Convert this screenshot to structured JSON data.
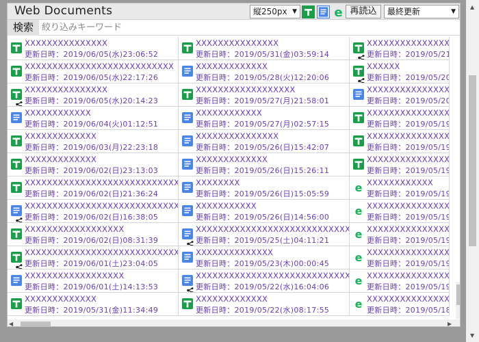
{
  "header": {
    "title": "Web Documents",
    "size_select": "縦250px",
    "reload_label": "再読込",
    "sort_select": "最終更新"
  },
  "search": {
    "label": "検索",
    "placeholder": "絞り込みキーワード",
    "value": ""
  },
  "colors": {
    "sheet": "#1a9e4a",
    "doc": "#4a86e8",
    "site": "#19b35a",
    "text": "#6a3db8"
  },
  "columns": [
    [
      {
        "type": "sheet-icon",
        "shared": false,
        "title": "XXXXXXXXXXXXXXX",
        "date": "更新日時：2019/06/05(水)23:06:52"
      },
      {
        "type": "sheet-icon",
        "shared": false,
        "title": "XXXXXXXXXXXXXXXXXXXXXXXXXXX",
        "date": "更新日時：2019/06/05(水)22:17:26"
      },
      {
        "type": "sheet-icon",
        "shared": true,
        "title": "XXXXXXXXXXXXXXX",
        "date": "更新日時：2019/06/05(水)20:14:23"
      },
      {
        "type": "doc-icon",
        "shared": false,
        "title": "XXXXXXXXXXXX",
        "date": "更新日時：2019/06/04(火)01:12:51"
      },
      {
        "type": "sheet-icon",
        "shared": false,
        "title": "XXXXXXXXXXXXX",
        "date": "更新日時：2019/06/03(月)22:23:18"
      },
      {
        "type": "sheet-icon",
        "shared": false,
        "title": "XXXXXXXXXXXXX",
        "date": "更新日時：2019/06/02(日)23:13:03"
      },
      {
        "type": "sheet-icon",
        "shared": false,
        "title": "XXXXXXXXXXXXXXXXXXXXXXXXXXXXXX",
        "date": "更新日時：2019/06/02(日)21:36:24"
      },
      {
        "type": "doc-icon",
        "shared": true,
        "title": "XXXXXXXXXXXXXXXXXXXXXXXXXXXXX",
        "date": "更新日時：2019/06/02(日)16:38:05"
      },
      {
        "type": "sheet-icon",
        "shared": false,
        "title": "XXXXXXXXXXXXXXXXXX",
        "date": "更新日時：2019/06/02(日)08:31:39"
      },
      {
        "type": "sheet-icon",
        "shared": true,
        "title": "XXXXXXXXXXXXXXXXXXXXXXXXXXXXX",
        "date": "更新日時：2019/06/01(土)23:04:05"
      },
      {
        "type": "doc-icon",
        "shared": false,
        "title": "XXXXXXXXXXXXXXXXXX",
        "date": "更新日時：2019/06/01(土)14:13:53"
      },
      {
        "type": "sheet-icon",
        "shared": false,
        "title": "XXXXXXXXXXXXX",
        "date": "更新日時：2019/05/31(金)11:34:49"
      }
    ],
    [
      {
        "type": "sheet-icon",
        "shared": false,
        "title": "XXXXXXXXXXXXXXX",
        "date": "更新日時：2019/05/31(金)03:59:14"
      },
      {
        "type": "doc-icon",
        "shared": false,
        "title": "XXXXXXXXXXXXX",
        "date": "更新日時：2019/05/28(火)12:20:06"
      },
      {
        "type": "sheet-icon",
        "shared": false,
        "title": "XXXXXXXXXXXXXXXXXX",
        "date": "更新日時：2019/05/27(月)21:58:01"
      },
      {
        "type": "doc-icon",
        "shared": false,
        "title": "XXXXXXXXXXXX",
        "date": "更新日時：2019/05/27(月)02:57:15"
      },
      {
        "type": "doc-icon",
        "shared": false,
        "title": "XXXXXXXXXXXXXXX",
        "date": "更新日時：2019/05/26(日)15:42:07"
      },
      {
        "type": "doc-icon",
        "shared": false,
        "title": "XXXXXXXXXXXXX",
        "date": "更新日時：2019/05/26(日)15:26:11"
      },
      {
        "type": "doc-icon",
        "shared": false,
        "title": "XXXXXXXX",
        "date": "更新日時：2019/05/26(日)15:05:59"
      },
      {
        "type": "doc-icon",
        "shared": false,
        "title": "XXXXXXXXXXX",
        "date": "更新日時：2019/05/26(日)14:56:00"
      },
      {
        "type": "doc-icon",
        "shared": true,
        "title": "XXXXXXXXXXXXXXXXXXXXXXXXXXXXXX…",
        "date": "更新日時：2019/05/25(土)04:11:21"
      },
      {
        "type": "doc-icon",
        "shared": false,
        "title": "XXXXXXXXXXXXXX",
        "date": "更新日時：2019/05/23(木)00:00:45"
      },
      {
        "type": "doc-icon",
        "shared": true,
        "title": "XXXXXXXXXXXXXXXXXXXXXXXXXXXXXX",
        "date": "更新日時：2019/05/22(水)16:04:06"
      },
      {
        "type": "sheet-icon",
        "shared": false,
        "title": "XXXXXXXXXXXXX",
        "date": "更新日時：2019/05/22(水)08:17:55"
      }
    ],
    [
      {
        "type": "sheet-icon",
        "shared": true,
        "title": "XXXXXXXXXXXXXXX",
        "date": "更新日時：2019/05/21(火"
      },
      {
        "type": "sheet-icon",
        "shared": true,
        "title": "XXXXXX",
        "date": "更新日時：2019/05/20(月"
      },
      {
        "type": "doc-icon",
        "shared": false,
        "title": "XXXXXXXXXXXXXXXXX",
        "date": "更新日時：2019/05/20(月"
      },
      {
        "type": "sheet-icon",
        "shared": false,
        "title": "XXXXXXXXXXXXXXXXX",
        "date": "更新日時：2019/05/19(日"
      },
      {
        "type": "sheet-icon",
        "shared": false,
        "title": "XXXXXXXXXXXXXXXXX",
        "date": "更新日時：2019/05/19(日"
      },
      {
        "type": "sheet-icon",
        "shared": false,
        "title": "XXXXXXXXXXXXXXXXX",
        "date": "更新日時：2019/05/19(日"
      },
      {
        "type": "site-icon",
        "shared": false,
        "title": "XXXXXXXXXXXX",
        "date": "更新日時：2019/05/19(日"
      },
      {
        "type": "site-icon",
        "shared": false,
        "title": "XXXXXXXXXXXXXXXXX",
        "date": "更新日時：2019/05/19(日"
      },
      {
        "type": "site-icon",
        "shared": false,
        "title": "XXXXXXXXXXXXXXXXX",
        "date": "更新日時：2019/05/19(日"
      },
      {
        "type": "site-icon",
        "shared": false,
        "title": "XXXXXXXXXXXXXXXXX",
        "date": "更新日時：2019/05/19(日"
      },
      {
        "type": "site-icon",
        "shared": false,
        "title": "XXXXXXXXXXXXXXXXX",
        "date": "更新日時：2019/05/19(日"
      },
      {
        "type": "site-icon",
        "shared": false,
        "title": "XXXXXXXXXXXXXXXXX",
        "date": "更新日時：2019/05/18(土"
      }
    ]
  ]
}
